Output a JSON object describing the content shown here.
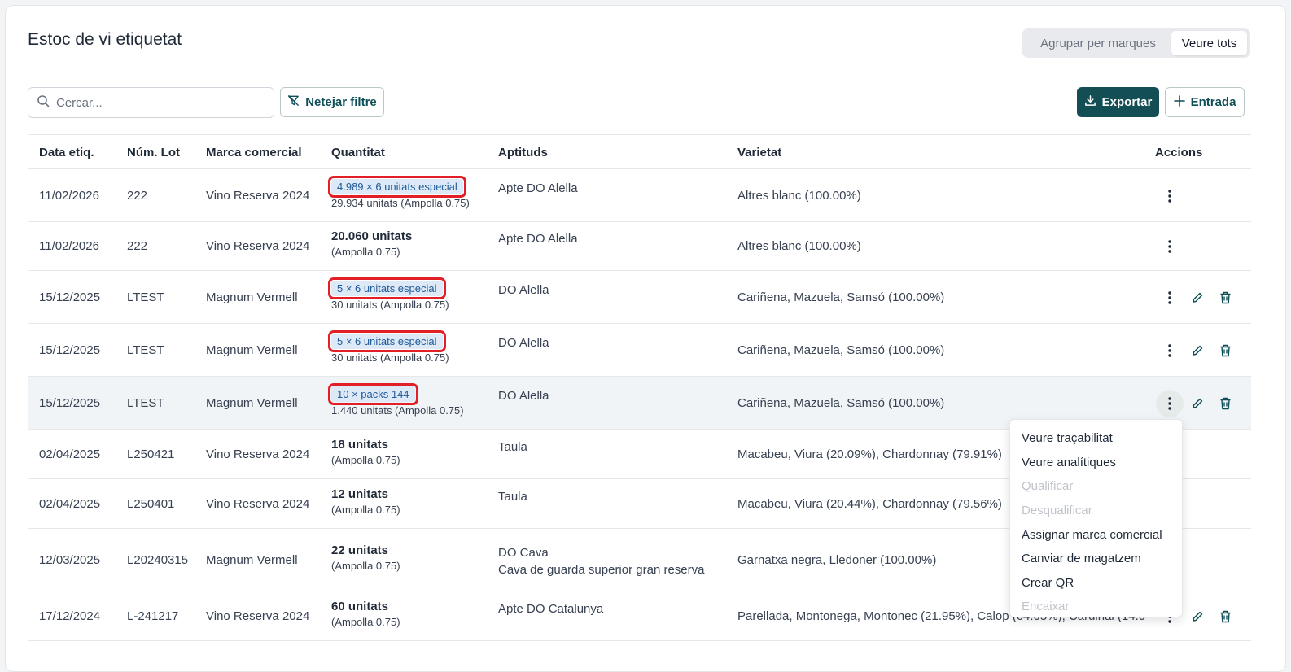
{
  "header": {
    "title": "Estoc de vi etiquetat",
    "toggle_group": "Agrupar per marques",
    "toggle_all": "Veure tots"
  },
  "toolbar": {
    "search_placeholder": "Cercar...",
    "clear_filter": "Netejar filtre",
    "export": "Exportar",
    "entry": "Entrada"
  },
  "columns": {
    "date": "Data etiq.",
    "lot": "Núm. Lot",
    "brand": "Marca comercial",
    "qty": "Quantitat",
    "aptitudes": "Aptituds",
    "variety": "Varietat",
    "actions": "Accions"
  },
  "rows": [
    {
      "date": "11/02/2026",
      "lot": "222",
      "brand": "Vino Reserva 2024",
      "qty_badge": "4.989 × 6 unitats especial",
      "qty_main": "",
      "qty_sub": "29.934 unitats (Ampolla 0.75)",
      "apt1": "Apte DO Alella",
      "apt2": "",
      "variety": "Altres blanc (100.00%)"
    },
    {
      "date": "11/02/2026",
      "lot": "222",
      "brand": "Vino Reserva 2024",
      "qty_badge": "",
      "qty_main": "20.060 unitats",
      "qty_sub": "(Ampolla 0.75)",
      "apt1": "Apte DO Alella",
      "apt2": "",
      "variety": "Altres blanc (100.00%)"
    },
    {
      "date": "15/12/2025",
      "lot": "LTEST",
      "brand": "Magnum Vermell",
      "qty_badge": "5 × 6 unitats especial",
      "qty_main": "",
      "qty_sub": "30 unitats (Ampolla 0.75)",
      "apt1": "DO Alella",
      "apt2": "",
      "variety": "Cariñena, Mazuela, Samsó (100.00%)"
    },
    {
      "date": "15/12/2025",
      "lot": "LTEST",
      "brand": "Magnum Vermell",
      "qty_badge": "5 × 6 unitats especial",
      "qty_main": "",
      "qty_sub": "30 unitats (Ampolla 0.75)",
      "apt1": "DO Alella",
      "apt2": "",
      "variety": "Cariñena, Mazuela, Samsó (100.00%)"
    },
    {
      "date": "15/12/2025",
      "lot": "LTEST",
      "brand": "Magnum Vermell",
      "qty_badge": "10 × packs 144",
      "qty_main": "",
      "qty_sub": "1.440 unitats (Ampolla 0.75)",
      "apt1": "DO Alella",
      "apt2": "",
      "variety": "Cariñena, Mazuela, Samsó (100.00%)"
    },
    {
      "date": "02/04/2025",
      "lot": "L250421",
      "brand": "Vino Reserva 2024",
      "qty_badge": "",
      "qty_main": "18 unitats",
      "qty_sub": "(Ampolla 0.75)",
      "apt1": "Taula",
      "apt2": "",
      "variety": "Macabeu, Viura (20.09%), Chardonnay (79.91%)"
    },
    {
      "date": "02/04/2025",
      "lot": "L250401",
      "brand": "Vino Reserva 2024",
      "qty_badge": "",
      "qty_main": "12 unitats",
      "qty_sub": "(Ampolla 0.75)",
      "apt1": "Taula",
      "apt2": "",
      "variety": "Macabeu, Viura (20.44%), Chardonnay (79.56%)"
    },
    {
      "date": "12/03/2025",
      "lot": "L20240315",
      "brand": "Magnum Vermell",
      "qty_badge": "",
      "qty_main": "22 unitats",
      "qty_sub": "(Ampolla 0.75)",
      "apt1": "DO Cava",
      "apt2": "Cava de guarda superior gran reserva",
      "variety": "Garnatxa negra, Lledoner (100.00%)"
    },
    {
      "date": "17/12/2024",
      "lot": "L-241217",
      "brand": "Vino Reserva 2024",
      "qty_badge": "",
      "qty_main": "60 unitats",
      "qty_sub": "(Ampolla 0.75)",
      "apt1": "Apte DO Catalunya",
      "apt2": "",
      "variety": "Parellada, Montonega, Montonec (21.95%), Calop (64.05%), Cardinal (14.0"
    }
  ],
  "menu": {
    "items": [
      {
        "label": "Veure traçabilitat",
        "disabled": false
      },
      {
        "label": "Veure analítiques",
        "disabled": false
      },
      {
        "label": "Qualificar",
        "disabled": true
      },
      {
        "label": "Desqualificar",
        "disabled": true
      },
      {
        "label": "Assignar marca comercial",
        "disabled": false
      },
      {
        "label": "Canviar de magatzem",
        "disabled": false
      },
      {
        "label": "Crear QR",
        "disabled": false
      },
      {
        "label": "Encaixar",
        "disabled": true
      }
    ]
  }
}
